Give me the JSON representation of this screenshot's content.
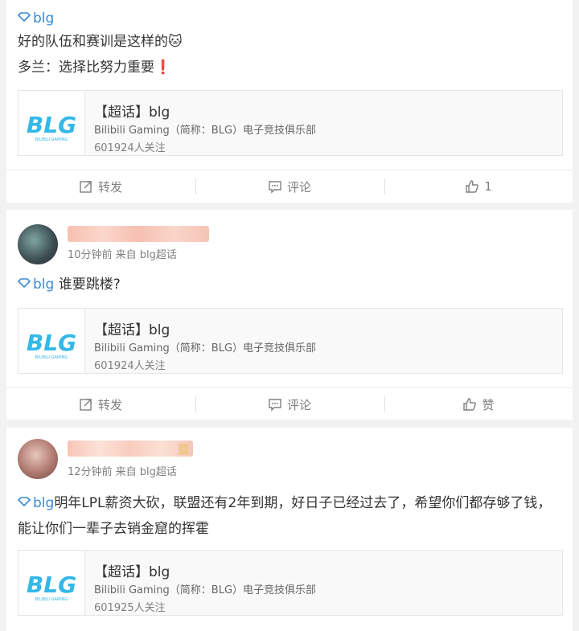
{
  "colors": {
    "accent": "#eb7350",
    "link": "#3a8ad4",
    "muted": "#808080"
  },
  "posts": [
    {
      "topic": "blg",
      "lines": [
        "好的队伍和赛训是这样的🐱",
        "多兰：选择比努力重要❗"
      ],
      "card": {
        "title": "【超话】blg",
        "desc": "Bilibili Gaming（简称：BLG）电子竞技俱乐部",
        "followers": "601924人关注"
      },
      "actions": {
        "repost": "转发",
        "comment": "评论",
        "like": "1"
      }
    },
    {
      "meta": "10分钟前 来自 blg超话",
      "topic": "blg",
      "text": "谁要跳楼?",
      "card": {
        "title": "【超话】blg",
        "desc": "Bilibili Gaming（简称：BLG）电子竞技俱乐部",
        "followers": "601924人关注"
      },
      "actions": {
        "repost": "转发",
        "comment": "评论",
        "like": "赞"
      }
    },
    {
      "meta": "12分钟前 来自 blg超话",
      "topic": "blg",
      "text": "明年LPL薪资大砍，联盟还有2年到期，好日子已经过去了，希望你们都存够了钱，能让你们一辈子去销金窟的挥霍",
      "card": {
        "title": "【超话】blg",
        "desc": "Bilibili Gaming（简称：BLG）电子竞技俱乐部",
        "followers": "601925人关注"
      }
    }
  ],
  "logo_text": "BLG",
  "logo_sub": "BILIBILI GAMING"
}
